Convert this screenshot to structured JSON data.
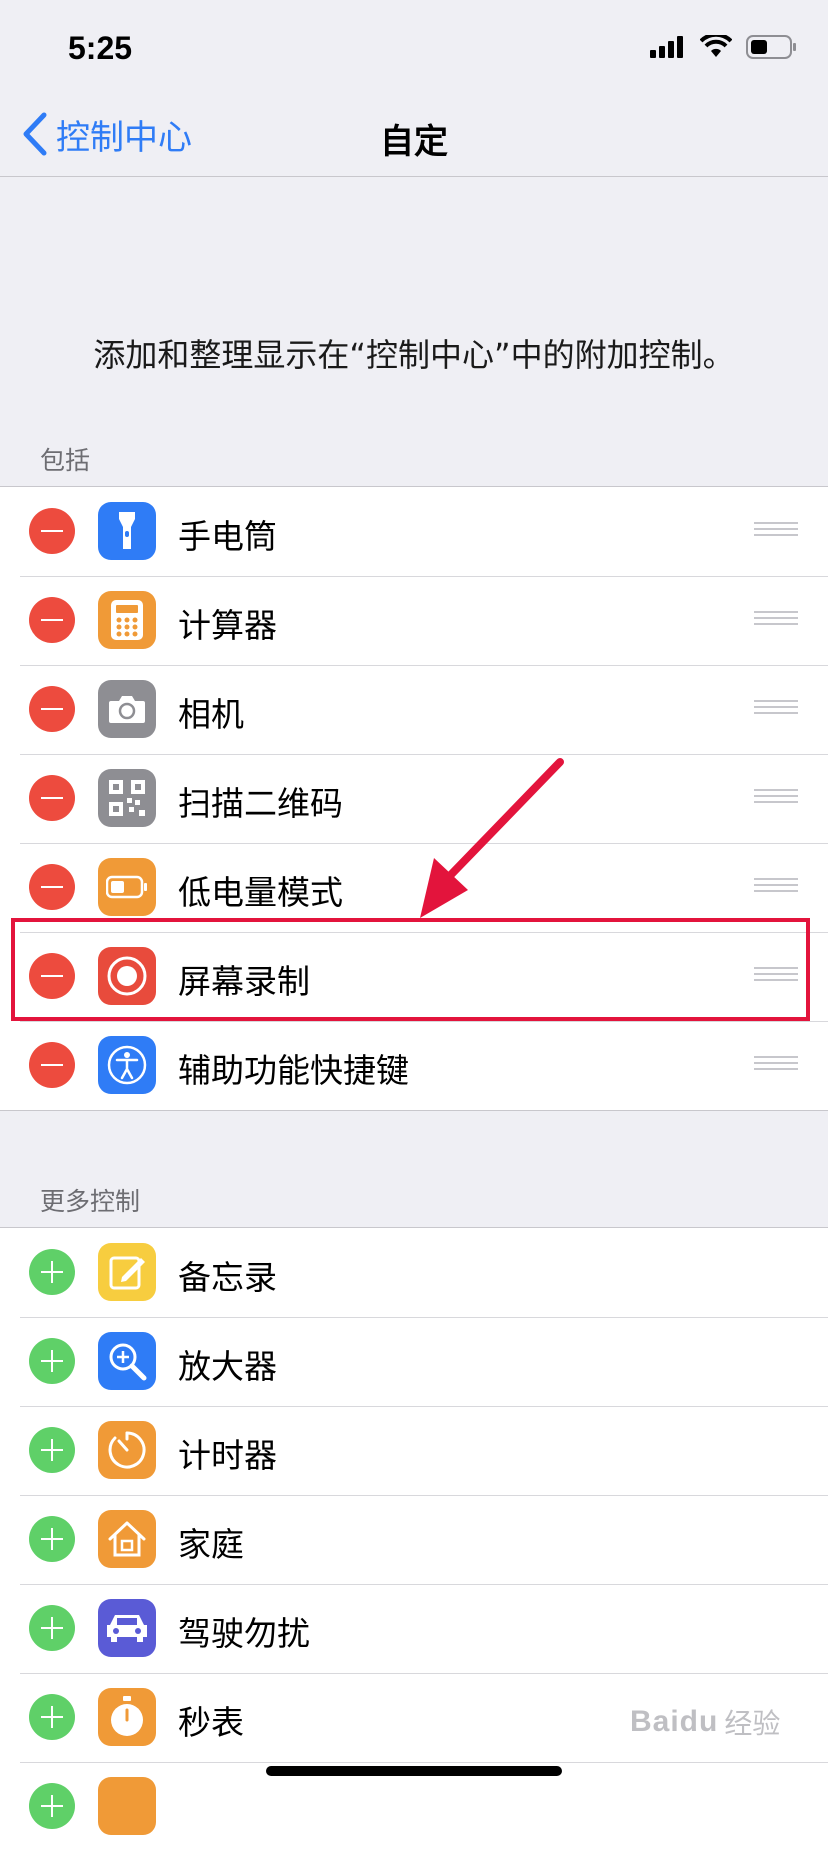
{
  "status_bar": {
    "time": "5:25"
  },
  "nav": {
    "back_label": "控制中心",
    "title": "自定"
  },
  "description": "添加和整理显示在“控制中心”中的附加控制。",
  "included": {
    "header": "包括",
    "items": [
      {
        "label": "手电筒",
        "icon": "flashlight-icon",
        "color": "#2f7cf6"
      },
      {
        "label": "计算器",
        "icon": "calculator-icon",
        "color": "#f09a37"
      },
      {
        "label": "相机",
        "icon": "camera-icon",
        "color": "#8e8e93"
      },
      {
        "label": "扫描二维码",
        "icon": "qr-code-icon",
        "color": "#8e8e93"
      },
      {
        "label": "低电量模式",
        "icon": "battery-icon",
        "color": "#f09a37"
      },
      {
        "label": "屏幕录制",
        "icon": "screen-record-icon",
        "color": "#e84b3c"
      },
      {
        "label": "辅助功能快捷键",
        "icon": "accessibility-icon",
        "color": "#2f7cf6"
      }
    ]
  },
  "more": {
    "header": "更多控制",
    "items": [
      {
        "label": "备忘录",
        "icon": "notes-icon",
        "color": "#f7cd3f"
      },
      {
        "label": "放大器",
        "icon": "magnifier-icon",
        "color": "#2f7cf6"
      },
      {
        "label": "计时器",
        "icon": "timer-icon",
        "color": "#f09a37"
      },
      {
        "label": "家庭",
        "icon": "home-icon",
        "color": "#f09a37"
      },
      {
        "label": "驾驶勿扰",
        "icon": "car-icon",
        "color": "#5a5bd6"
      },
      {
        "label": "秒表",
        "icon": "stopwatch-icon",
        "color": "#f09a37"
      }
    ]
  },
  "annotation": {
    "highlight_color": "#e3143c",
    "highlighted_item": "屏幕录制"
  },
  "watermark": {
    "brand": "Baidu",
    "suffix": "经验"
  }
}
